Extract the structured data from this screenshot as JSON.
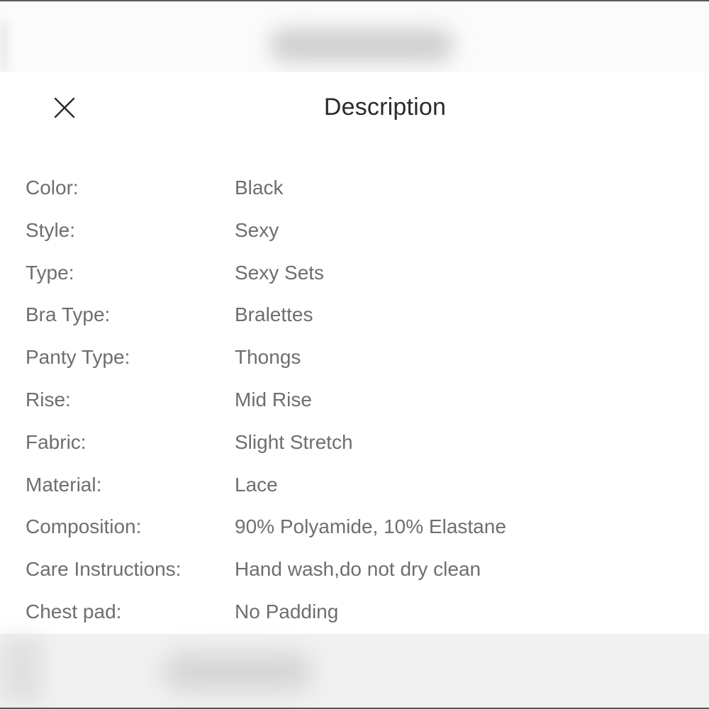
{
  "header": {
    "title": "Description",
    "close_icon": "close-icon"
  },
  "specs": [
    {
      "label": "Color:",
      "value": "Black"
    },
    {
      "label": "Style:",
      "value": "Sexy"
    },
    {
      "label": "Type:",
      "value": "Sexy Sets"
    },
    {
      "label": "Bra Type:",
      "value": "Bralettes"
    },
    {
      "label": "Panty Type:",
      "value": "Thongs"
    },
    {
      "label": "Rise:",
      "value": "Mid Rise"
    },
    {
      "label": "Fabric:",
      "value": "Slight Stretch"
    },
    {
      "label": "Material:",
      "value": "Lace"
    },
    {
      "label": "Composition:",
      "value": "90% Polyamide, 10% Elastane"
    },
    {
      "label": "Care Instructions:",
      "value": "Hand wash,do not dry clean"
    },
    {
      "label": "Chest pad:",
      "value": "No Padding"
    }
  ],
  "colors": {
    "text_label": "#6e6e6e",
    "text_title": "#2a2a2a",
    "background": "#ffffff"
  }
}
